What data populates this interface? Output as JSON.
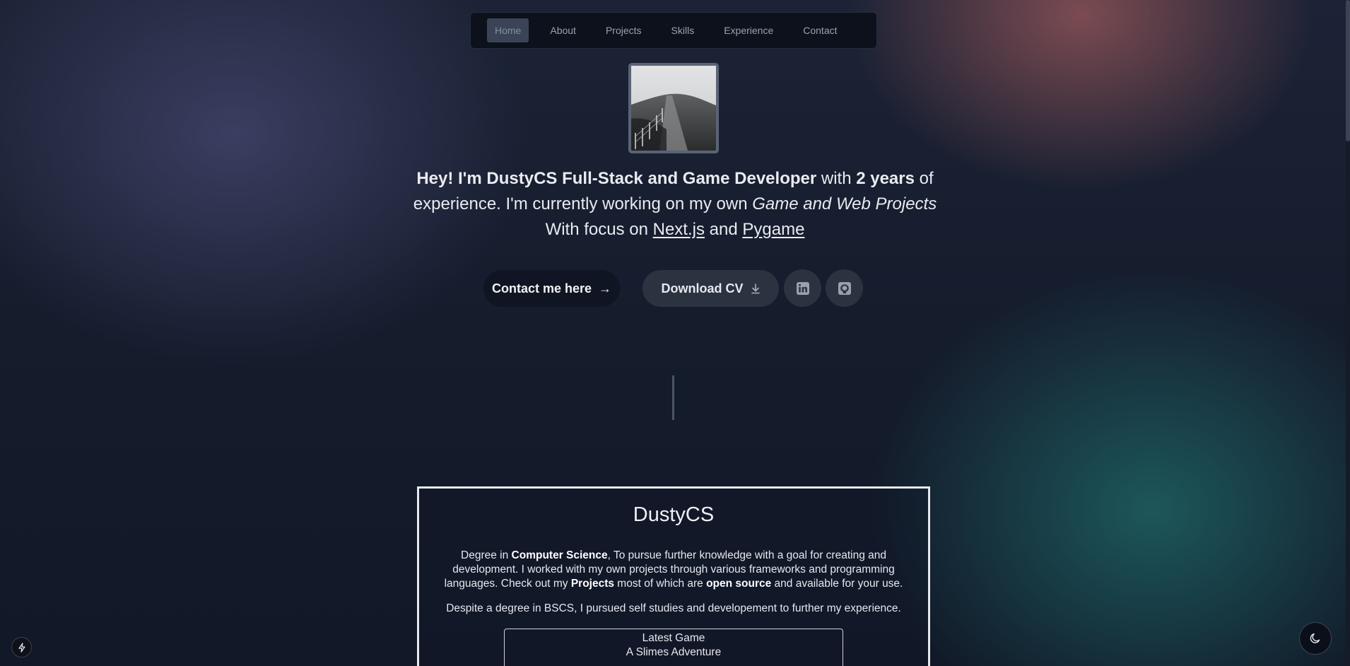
{
  "nav": {
    "items": [
      {
        "label": "Home",
        "active": true
      },
      {
        "label": "About"
      },
      {
        "label": "Projects"
      },
      {
        "label": "Skills"
      },
      {
        "label": "Experience"
      },
      {
        "label": "Contact"
      }
    ]
  },
  "hero": {
    "intro_bold_1": "Hey! I'm DustyCS Full-Stack and Game Developer",
    "intro_text_1": " with ",
    "intro_bold_2": "2 years",
    "intro_text_2": " of experience. I'm currently working on my own ",
    "intro_italic": "Game and Web Projects",
    "intro_text_3": "With focus on ",
    "link_nextjs": "Next.js",
    "intro_text_4": " and ",
    "link_pygame": "Pygame",
    "contact_button": "Contact me here",
    "contact_arrow": "→",
    "cv_button": "Download CV",
    "linkedin_icon": "linkedin-icon",
    "github_icon": "github-icon"
  },
  "about": {
    "title": "DustyCS",
    "p1_text_1": "Degree in ",
    "p1_bold_1": "Computer Science",
    "p1_text_2": ", To pursue further knowledge with a goal for creating and development. I worked with my own projects through various frameworks and programming languages. Check out my ",
    "p1_bold_2": "Projects",
    "p1_text_3": " most of which are ",
    "p1_bold_3": "open source",
    "p1_text_4": " and available for your use.",
    "p2": "Despite a degree in BSCS, I pursued self studies and developement to further my experience.",
    "latest_label": "Latest Game",
    "latest_title": "A Slimes Adventure"
  },
  "floating": {
    "bolt_icon": "bolt-icon",
    "theme_icon": "moon-icon"
  },
  "colors": {
    "accent_salmon": "#8c5256",
    "accent_teal": "#1e6264",
    "accent_indigo": "#464870"
  }
}
